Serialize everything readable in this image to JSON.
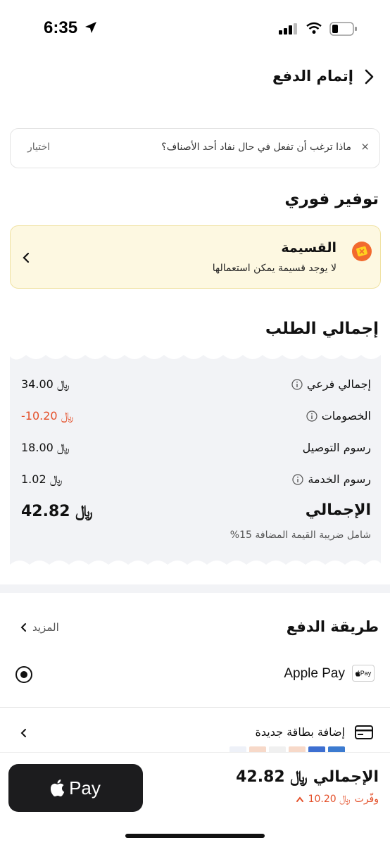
{
  "status_bar": {
    "time": "6:35"
  },
  "header": {
    "title": "إتمام الدفع"
  },
  "out_of_stock": {
    "question": "ماذا ترغب أن تفعل في حال نفاد أحد الأصناف؟",
    "select_label": "اختيار",
    "close_symbol": "×"
  },
  "instant_savings": {
    "title": "توفير فوري",
    "voucher_title": "القسيمة",
    "voucher_subtitle": "لا يوجد قسيمة يمكن استعمالها"
  },
  "order_summary": {
    "title": "إجمالي الطلب",
    "rows": [
      {
        "label": "إجمالي فرعي",
        "value": "34.00 ﷼",
        "info": true
      },
      {
        "label": "الخصومات",
        "value": "-10.20 ﷼",
        "info": true
      },
      {
        "label": "رسوم التوصيل",
        "value": "18.00 ﷼",
        "info": false
      },
      {
        "label": "رسوم الخدمة",
        "value": "1.02 ﷼",
        "info": true
      }
    ],
    "total_label": "الإجمالي",
    "total_value": "42.82 ﷼",
    "vat_note": "شامل ضريبة القيمة المضافة 15%"
  },
  "payment": {
    "title": "طريقة الدفع",
    "more_label": "المزيد",
    "apple_pay_label": "Apple Pay",
    "apple_pay_logo_text": "Pay",
    "add_card_label": "إضافة بطاقة جديدة"
  },
  "bottom_bar": {
    "pay_button_label": "Pay",
    "total_label": "الإجمالي",
    "total_value": "42.82 ﷼",
    "saved_label": "وفّرت",
    "saved_value": "10.20 ﷼"
  },
  "colors": {
    "accent_discount": "#e4502a",
    "voucher_bg": "#fdf8e1",
    "summary_bg": "#f2f3f6",
    "pay_button_bg": "#1c1c1e"
  }
}
